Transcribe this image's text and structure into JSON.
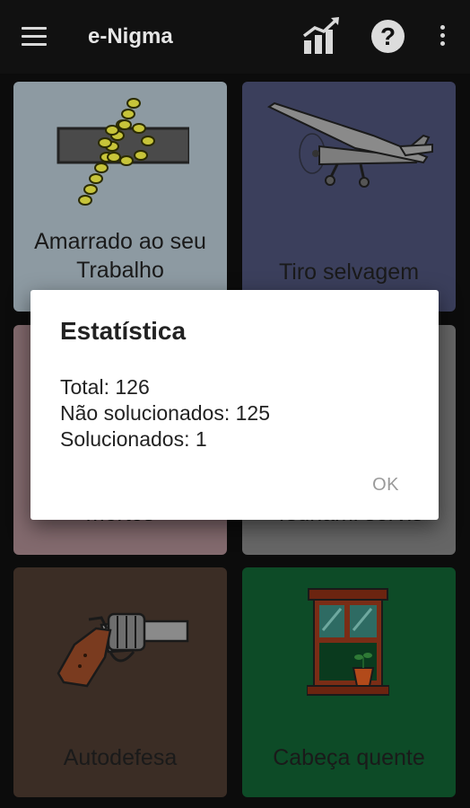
{
  "appbar": {
    "title": "e-Nigma",
    "menu_icon": "hamburger-menu-icon",
    "stats_icon": "bar-chart-icon",
    "help_icon": "question-mark-icon",
    "help_glyph": "?",
    "more_icon": "more-vert-icon"
  },
  "tiles": [
    {
      "label_line1": "Amarrado ao seu",
      "label_line2": "Trabalho",
      "icon": "knot-icon",
      "color": "#8d9aa2"
    },
    {
      "label_line1": "Tiro selvagem",
      "icon": "airplane-icon",
      "color": "#3b3f5c"
    },
    {
      "label_line1": "mortos",
      "icon": "",
      "color": "#836a6e"
    },
    {
      "label_line1": "Tsunami servis",
      "icon": "",
      "color": "#666666"
    },
    {
      "label_line1": "Autodefesa",
      "icon": "revolver-icon",
      "color": "#3b2d25"
    },
    {
      "label_line1": "Cabeça quente",
      "icon": "window-icon",
      "color": "#0d4b27"
    }
  ],
  "dialog": {
    "title": "Estatística",
    "total": "Total: 126",
    "unsolved": "Não solucionados: 125",
    "solved": "Solucionados: 1",
    "ok_label": "OK"
  }
}
